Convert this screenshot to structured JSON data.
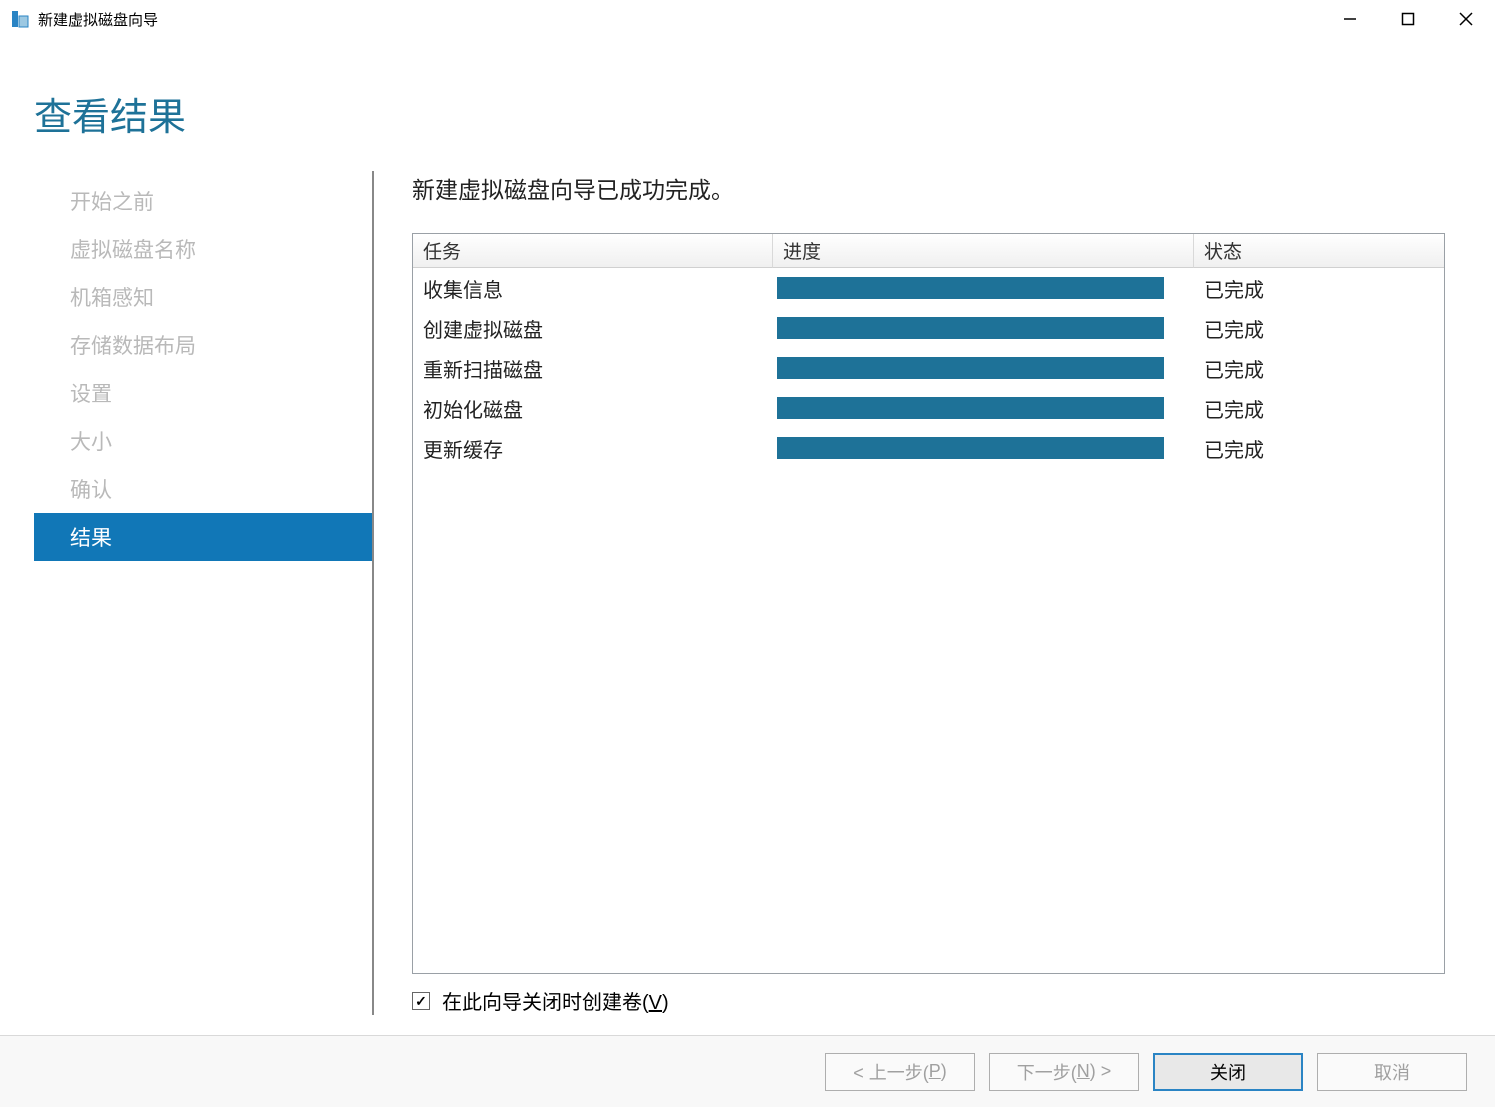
{
  "window": {
    "title": "新建虚拟磁盘向导"
  },
  "heading": "查看结果",
  "sidebar": {
    "items": [
      {
        "label": "开始之前",
        "active": false
      },
      {
        "label": "虚拟磁盘名称",
        "active": false
      },
      {
        "label": "机箱感知",
        "active": false
      },
      {
        "label": "存储数据布局",
        "active": false
      },
      {
        "label": "设置",
        "active": false
      },
      {
        "label": "大小",
        "active": false
      },
      {
        "label": "确认",
        "active": false
      },
      {
        "label": "结果",
        "active": true
      }
    ]
  },
  "panel": {
    "message": "新建虚拟磁盘向导已成功完成。",
    "columns": {
      "task": "任务",
      "progress": "进度",
      "status": "状态"
    },
    "rows": [
      {
        "task": "收集信息",
        "progress": 100,
        "status": "已完成"
      },
      {
        "task": "创建虚拟磁盘",
        "progress": 100,
        "status": "已完成"
      },
      {
        "task": "重新扫描磁盘",
        "progress": 100,
        "status": "已完成"
      },
      {
        "task": "初始化磁盘",
        "progress": 100,
        "status": "已完成"
      },
      {
        "task": "更新缓存",
        "progress": 100,
        "status": "已完成"
      }
    ],
    "checkbox": {
      "checked": true,
      "label_prefix": "在此向导关闭时创建卷(",
      "label_hotkey": "V",
      "label_suffix": ")"
    }
  },
  "footer": {
    "prev_prefix": "< 上一步(",
    "prev_hotkey": "P",
    "prev_suffix": ")",
    "next_prefix": "下一步(",
    "next_hotkey": "N",
    "next_suffix": ") >",
    "close": "关闭",
    "cancel": "取消"
  }
}
